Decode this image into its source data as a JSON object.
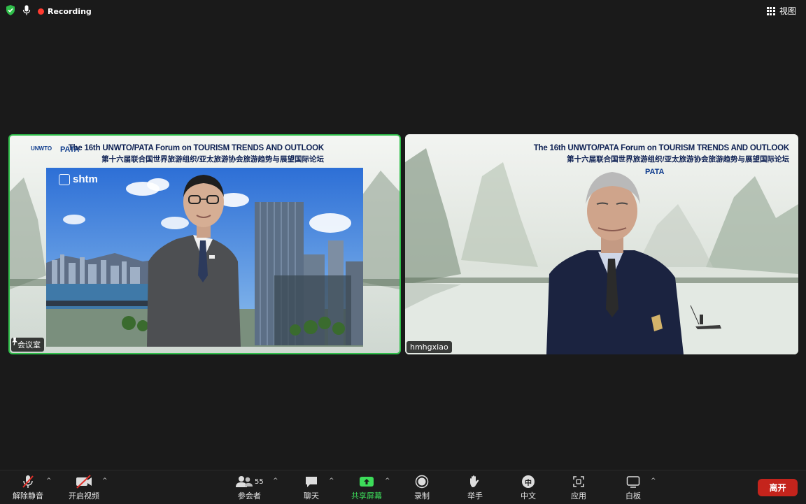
{
  "topbar": {
    "recording_label": "Recording",
    "view_label": "视图"
  },
  "tiles": [
    {
      "name_label": "会议室",
      "banner_en": "The 16th UNWTO/PATA Forum on TOURISM TRENDS AND OUTLOOK",
      "banner_zh": "第十六届联合国世界旅游组织/亚太旅游协会旅游趋势与展望国际论坛",
      "logo_left": "UNWTO",
      "logo_right": "PATA",
      "backdrop_logo": "shtm",
      "active_speaker": true
    },
    {
      "name_label": "hmhgxiao",
      "banner_en": "The 16th UNWTO/PATA Forum on TOURISM TRENDS AND OUTLOOK",
      "banner_zh": "第十六届联合国世界旅游组织/亚太旅游协会旅游趋势与展望国际论坛",
      "logo_right": "PATA"
    }
  ],
  "toolbar": {
    "unmute": "解除静音",
    "start_video": "开启视频",
    "participants": "参会者",
    "participant_count": "55",
    "chat": "聊天",
    "share": "共享屏幕",
    "record": "录制",
    "raise_hand": "举手",
    "language": "中文",
    "language_glyph": "中",
    "apps": "应用",
    "whiteboard": "白板",
    "leave": "离开"
  },
  "colors": {
    "active_border": "#2fbf4a",
    "leave_button": "#c4241c",
    "share_green": "#3ddc5a",
    "recording_dot": "#ff3b30"
  }
}
